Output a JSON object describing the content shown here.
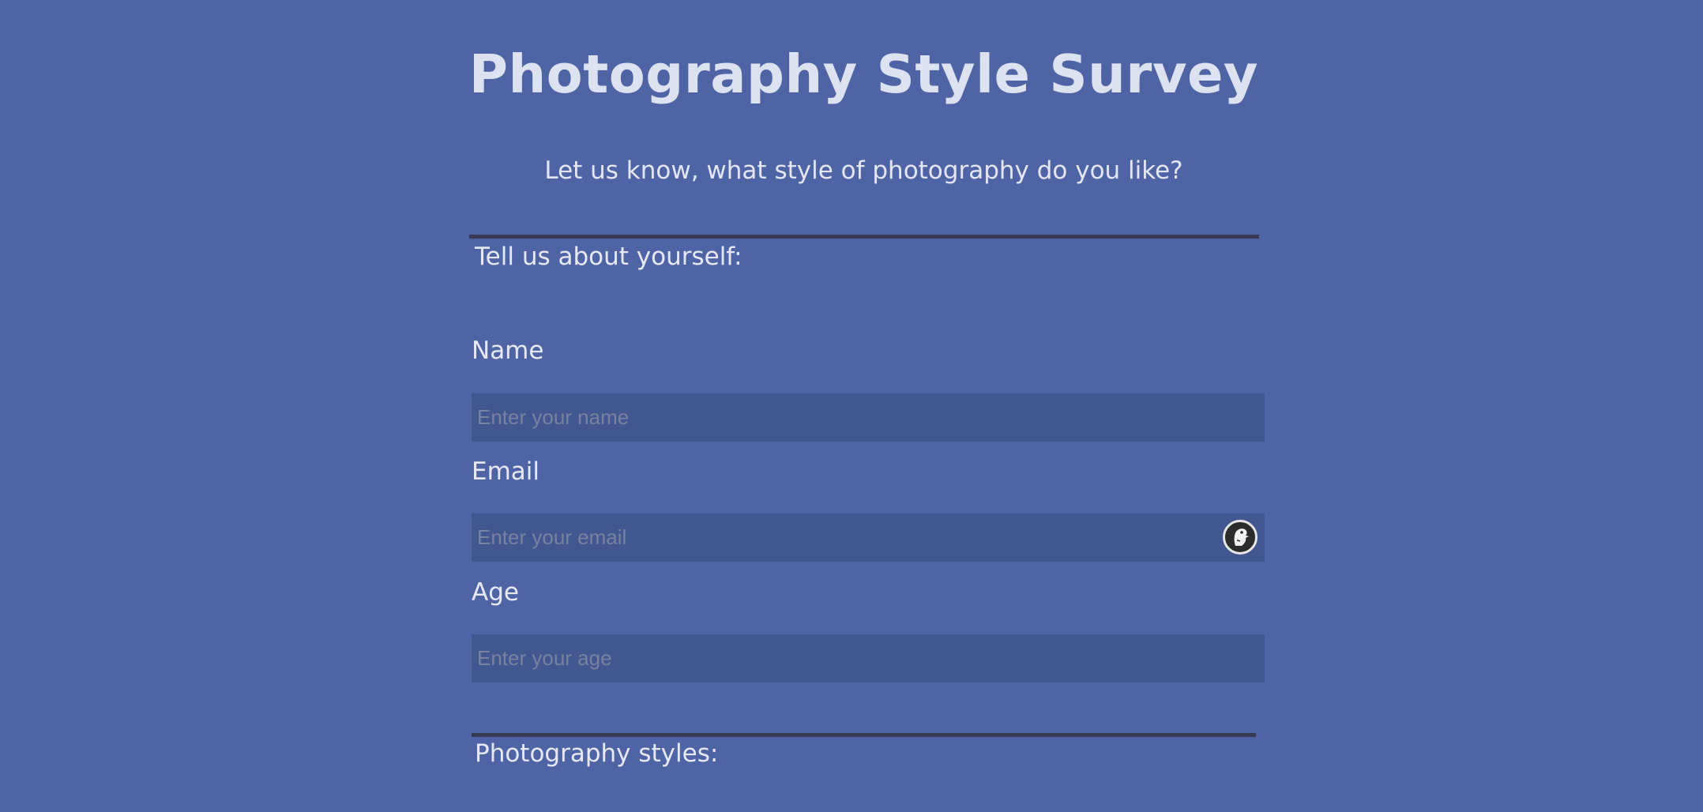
{
  "header": {
    "title": "Photography Style Survey",
    "description": "Let us know, what style of photography do you like?"
  },
  "sections": {
    "about": {
      "legend": "Tell us about yourself:"
    },
    "styles": {
      "legend": "Photography styles:"
    }
  },
  "form": {
    "name": {
      "label": "Name",
      "placeholder": "Enter your name",
      "value": ""
    },
    "email": {
      "label": "Email",
      "placeholder": "Enter your email",
      "value": ""
    },
    "age": {
      "label": "Age",
      "placeholder": "Enter your age",
      "value": ""
    }
  },
  "icons": {
    "email_autofill": "duckduckgo-autofill-icon"
  },
  "colors": {
    "background": "#4f64a5",
    "input_background": "#42578f",
    "divider": "#363a52",
    "text": "#e3e6f2",
    "placeholder": "#7882a0"
  }
}
